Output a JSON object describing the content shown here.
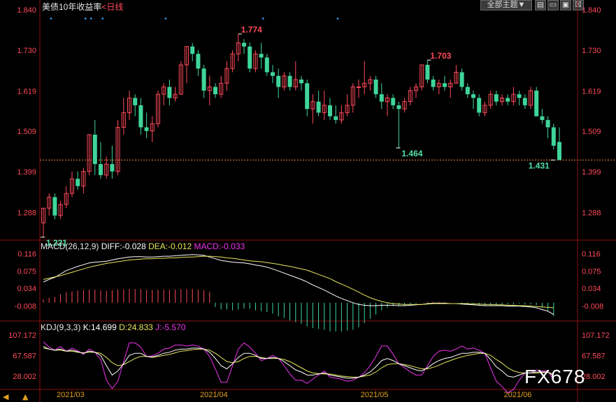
{
  "header": {
    "title": "美债10年收益率",
    "period_label": "<日线",
    "theme_button": "全部主题▼"
  },
  "colors": {
    "up": "#ff4a5a",
    "down": "#3fd59a",
    "label_up": "#ff4a5a",
    "label_down": "#54e0a6",
    "diff": "#ffffff",
    "dea": "#e6e65c",
    "macd": "#ee33ee",
    "k": "#ffffff",
    "d": "#e6e65c",
    "j": "#ee33ee",
    "axis_text": "#ff4a5a",
    "x_axis_text": "#e0a020",
    "grid": "#8b1010",
    "current_line": "#ff8c3a"
  },
  "chart_data": [
    {
      "type": "candlestick",
      "title": "美债10年收益率",
      "y_ticks": [
        "1.840",
        "1.730",
        "1.619",
        "1.509",
        "1.399",
        "1.288"
      ],
      "ylim": [
        1.215,
        1.84
      ],
      "x_ticks": [
        "2021/03",
        "2021/04",
        "2021/05",
        "2021/06"
      ],
      "current_value": 1.431,
      "annotations": [
        {
          "text": "1.774",
          "value": 1.774,
          "kind": "high"
        },
        {
          "text": "1.703",
          "value": 1.703,
          "kind": "high"
        },
        {
          "text": "1.464",
          "value": 1.464,
          "kind": "low"
        },
        {
          "text": "1.431",
          "value": 1.431,
          "kind": "low"
        },
        {
          "text": "1.221",
          "value": 1.221,
          "kind": "low"
        }
      ],
      "candles": [
        {
          "o": 1.26,
          "h": 1.3,
          "l": 1.221,
          "c": 1.3
        },
        {
          "o": 1.3,
          "h": 1.34,
          "l": 1.28,
          "c": 1.33
        },
        {
          "o": 1.33,
          "h": 1.34,
          "l": 1.27,
          "c": 1.28
        },
        {
          "o": 1.28,
          "h": 1.32,
          "l": 1.27,
          "c": 1.31
        },
        {
          "o": 1.31,
          "h": 1.36,
          "l": 1.3,
          "c": 1.34
        },
        {
          "o": 1.34,
          "h": 1.4,
          "l": 1.33,
          "c": 1.38
        },
        {
          "o": 1.38,
          "h": 1.4,
          "l": 1.35,
          "c": 1.36
        },
        {
          "o": 1.36,
          "h": 1.41,
          "l": 1.34,
          "c": 1.4
        },
        {
          "o": 1.4,
          "h": 1.5,
          "l": 1.39,
          "c": 1.5
        },
        {
          "o": 1.5,
          "h": 1.54,
          "l": 1.39,
          "c": 1.42
        },
        {
          "o": 1.42,
          "h": 1.48,
          "l": 1.38,
          "c": 1.39
        },
        {
          "o": 1.39,
          "h": 1.44,
          "l": 1.38,
          "c": 1.42
        },
        {
          "o": 1.42,
          "h": 1.47,
          "l": 1.38,
          "c": 1.4
        },
        {
          "o": 1.4,
          "h": 1.54,
          "l": 1.39,
          "c": 1.52
        },
        {
          "o": 1.52,
          "h": 1.6,
          "l": 1.5,
          "c": 1.56
        },
        {
          "o": 1.56,
          "h": 1.62,
          "l": 1.54,
          "c": 1.6
        },
        {
          "o": 1.6,
          "h": 1.61,
          "l": 1.55,
          "c": 1.58
        },
        {
          "o": 1.58,
          "h": 1.6,
          "l": 1.5,
          "c": 1.52
        },
        {
          "o": 1.52,
          "h": 1.56,
          "l": 1.49,
          "c": 1.51
        },
        {
          "o": 1.51,
          "h": 1.55,
          "l": 1.48,
          "c": 1.53
        },
        {
          "o": 1.53,
          "h": 1.62,
          "l": 1.52,
          "c": 1.61
        },
        {
          "o": 1.61,
          "h": 1.64,
          "l": 1.58,
          "c": 1.63
        },
        {
          "o": 1.63,
          "h": 1.65,
          "l": 1.58,
          "c": 1.6
        },
        {
          "o": 1.6,
          "h": 1.63,
          "l": 1.59,
          "c": 1.61
        },
        {
          "o": 1.61,
          "h": 1.7,
          "l": 1.61,
          "c": 1.69
        },
        {
          "o": 1.69,
          "h": 1.74,
          "l": 1.64,
          "c": 1.74
        },
        {
          "o": 1.74,
          "h": 1.75,
          "l": 1.7,
          "c": 1.72
        },
        {
          "o": 1.72,
          "h": 1.73,
          "l": 1.66,
          "c": 1.68
        },
        {
          "o": 1.68,
          "h": 1.69,
          "l": 1.6,
          "c": 1.62
        },
        {
          "o": 1.62,
          "h": 1.66,
          "l": 1.58,
          "c": 1.63
        },
        {
          "o": 1.63,
          "h": 1.64,
          "l": 1.6,
          "c": 1.61
        },
        {
          "o": 1.61,
          "h": 1.66,
          "l": 1.6,
          "c": 1.64
        },
        {
          "o": 1.64,
          "h": 1.7,
          "l": 1.62,
          "c": 1.68
        },
        {
          "o": 1.68,
          "h": 1.73,
          "l": 1.67,
          "c": 1.72
        },
        {
          "o": 1.72,
          "h": 1.774,
          "l": 1.7,
          "c": 1.75
        },
        {
          "o": 1.75,
          "h": 1.76,
          "l": 1.72,
          "c": 1.74
        },
        {
          "o": 1.74,
          "h": 1.75,
          "l": 1.67,
          "c": 1.68
        },
        {
          "o": 1.68,
          "h": 1.73,
          "l": 1.67,
          "c": 1.72
        },
        {
          "o": 1.72,
          "h": 1.75,
          "l": 1.68,
          "c": 1.71
        },
        {
          "o": 1.71,
          "h": 1.72,
          "l": 1.66,
          "c": 1.67
        },
        {
          "o": 1.67,
          "h": 1.69,
          "l": 1.64,
          "c": 1.66
        },
        {
          "o": 1.66,
          "h": 1.68,
          "l": 1.6,
          "c": 1.63
        },
        {
          "o": 1.63,
          "h": 1.67,
          "l": 1.62,
          "c": 1.66
        },
        {
          "o": 1.66,
          "h": 1.67,
          "l": 1.62,
          "c": 1.63
        },
        {
          "o": 1.63,
          "h": 1.7,
          "l": 1.62,
          "c": 1.65
        },
        {
          "o": 1.65,
          "h": 1.66,
          "l": 1.62,
          "c": 1.64
        },
        {
          "o": 1.64,
          "h": 1.65,
          "l": 1.55,
          "c": 1.57
        },
        {
          "o": 1.57,
          "h": 1.61,
          "l": 1.53,
          "c": 1.59
        },
        {
          "o": 1.59,
          "h": 1.62,
          "l": 1.55,
          "c": 1.56
        },
        {
          "o": 1.56,
          "h": 1.62,
          "l": 1.54,
          "c": 1.58
        },
        {
          "o": 1.58,
          "h": 1.6,
          "l": 1.54,
          "c": 1.55
        },
        {
          "o": 1.55,
          "h": 1.58,
          "l": 1.53,
          "c": 1.54
        },
        {
          "o": 1.54,
          "h": 1.58,
          "l": 1.53,
          "c": 1.56
        },
        {
          "o": 1.56,
          "h": 1.61,
          "l": 1.55,
          "c": 1.58
        },
        {
          "o": 1.58,
          "h": 1.64,
          "l": 1.56,
          "c": 1.63
        },
        {
          "o": 1.63,
          "h": 1.65,
          "l": 1.6,
          "c": 1.63
        },
        {
          "o": 1.63,
          "h": 1.7,
          "l": 1.61,
          "c": 1.64
        },
        {
          "o": 1.64,
          "h": 1.66,
          "l": 1.62,
          "c": 1.65
        },
        {
          "o": 1.65,
          "h": 1.66,
          "l": 1.6,
          "c": 1.61
        },
        {
          "o": 1.61,
          "h": 1.64,
          "l": 1.57,
          "c": 1.59
        },
        {
          "o": 1.59,
          "h": 1.61,
          "l": 1.55,
          "c": 1.6
        },
        {
          "o": 1.6,
          "h": 1.61,
          "l": 1.57,
          "c": 1.58
        },
        {
          "o": 1.58,
          "h": 1.59,
          "l": 1.464,
          "c": 1.57
        },
        {
          "o": 1.57,
          "h": 1.6,
          "l": 1.56,
          "c": 1.59
        },
        {
          "o": 1.59,
          "h": 1.63,
          "l": 1.58,
          "c": 1.62
        },
        {
          "o": 1.62,
          "h": 1.64,
          "l": 1.6,
          "c": 1.63
        },
        {
          "o": 1.63,
          "h": 1.69,
          "l": 1.62,
          "c": 1.69
        },
        {
          "o": 1.69,
          "h": 1.703,
          "l": 1.64,
          "c": 1.65
        },
        {
          "o": 1.65,
          "h": 1.66,
          "l": 1.62,
          "c": 1.63
        },
        {
          "o": 1.63,
          "h": 1.65,
          "l": 1.61,
          "c": 1.64
        },
        {
          "o": 1.64,
          "h": 1.66,
          "l": 1.62,
          "c": 1.63
        },
        {
          "o": 1.63,
          "h": 1.65,
          "l": 1.6,
          "c": 1.64
        },
        {
          "o": 1.64,
          "h": 1.69,
          "l": 1.64,
          "c": 1.67
        },
        {
          "o": 1.67,
          "h": 1.68,
          "l": 1.62,
          "c": 1.63
        },
        {
          "o": 1.63,
          "h": 1.64,
          "l": 1.6,
          "c": 1.61
        },
        {
          "o": 1.61,
          "h": 1.62,
          "l": 1.57,
          "c": 1.6
        },
        {
          "o": 1.6,
          "h": 1.61,
          "l": 1.55,
          "c": 1.56
        },
        {
          "o": 1.56,
          "h": 1.59,
          "l": 1.55,
          "c": 1.58
        },
        {
          "o": 1.58,
          "h": 1.62,
          "l": 1.57,
          "c": 1.61
        },
        {
          "o": 1.61,
          "h": 1.62,
          "l": 1.58,
          "c": 1.59
        },
        {
          "o": 1.59,
          "h": 1.61,
          "l": 1.58,
          "c": 1.6
        },
        {
          "o": 1.6,
          "h": 1.61,
          "l": 1.58,
          "c": 1.59
        },
        {
          "o": 1.59,
          "h": 1.63,
          "l": 1.58,
          "c": 1.61
        },
        {
          "o": 1.61,
          "h": 1.62,
          "l": 1.58,
          "c": 1.6
        },
        {
          "o": 1.6,
          "h": 1.61,
          "l": 1.57,
          "c": 1.58
        },
        {
          "o": 1.58,
          "h": 1.63,
          "l": 1.57,
          "c": 1.62
        },
        {
          "o": 1.62,
          "h": 1.63,
          "l": 1.55,
          "c": 1.55
        },
        {
          "o": 1.55,
          "h": 1.57,
          "l": 1.53,
          "c": 1.54
        },
        {
          "o": 1.54,
          "h": 1.55,
          "l": 1.49,
          "c": 1.52
        },
        {
          "o": 1.52,
          "h": 1.53,
          "l": 1.46,
          "c": 1.47
        },
        {
          "o": 1.48,
          "h": 1.52,
          "l": 1.431,
          "c": 1.431
        }
      ]
    },
    {
      "type": "line",
      "title": "MACD(26,12,9)",
      "legend": [
        {
          "name": "DIFF:-0.028",
          "color_key": "diff"
        },
        {
          "name": "DEA:-0.012",
          "color_key": "dea"
        },
        {
          "name": "MACD:-0.033",
          "color_key": "macd"
        }
      ],
      "y_ticks": [
        "0.116",
        "0.075",
        "0.034",
        "-0.008"
      ],
      "ylim": [
        -0.04,
        0.125
      ],
      "diff": [
        0.049,
        0.055,
        0.06,
        0.068,
        0.076,
        0.081,
        0.086,
        0.09,
        0.094,
        0.096,
        0.097,
        0.098,
        0.101,
        0.104,
        0.106,
        0.108,
        0.109,
        0.109,
        0.108,
        0.108,
        0.109,
        0.11,
        0.11,
        0.111,
        0.112,
        0.113,
        0.114,
        0.113,
        0.112,
        0.108,
        0.104,
        0.1,
        0.098,
        0.096,
        0.095,
        0.094,
        0.092,
        0.089,
        0.087,
        0.084,
        0.08,
        0.075,
        0.07,
        0.065,
        0.06,
        0.055,
        0.049,
        0.042,
        0.036,
        0.03,
        0.023,
        0.016,
        0.01,
        0.005,
        0.0,
        -0.004,
        -0.006,
        -0.007,
        -0.007,
        -0.006,
        -0.006,
        -0.006,
        -0.007,
        -0.007,
        -0.006,
        -0.005,
        -0.004,
        -0.002,
        -0.001,
        -0.001,
        -0.001,
        -0.002,
        -0.002,
        -0.003,
        -0.004,
        -0.005,
        -0.006,
        -0.007,
        -0.007,
        -0.007,
        -0.007,
        -0.008,
        -0.008,
        -0.008,
        -0.009,
        -0.01,
        -0.012,
        -0.016,
        -0.02,
        -0.028
      ],
      "dea": [
        0.055,
        0.058,
        0.061,
        0.064,
        0.068,
        0.072,
        0.076,
        0.08,
        0.084,
        0.087,
        0.09,
        0.093,
        0.095,
        0.097,
        0.099,
        0.101,
        0.102,
        0.103,
        0.104,
        0.104,
        0.105,
        0.105,
        0.106,
        0.106,
        0.107,
        0.108,
        0.108,
        0.109,
        0.11,
        0.11,
        0.109,
        0.108,
        0.106,
        0.105,
        0.103,
        0.101,
        0.099,
        0.098,
        0.097,
        0.095,
        0.093,
        0.091,
        0.088,
        0.086,
        0.083,
        0.08,
        0.077,
        0.072,
        0.067,
        0.062,
        0.057,
        0.05,
        0.044,
        0.038,
        0.032,
        0.025,
        0.018,
        0.012,
        0.007,
        0.003,
        0.0,
        -0.002,
        -0.003,
        -0.004,
        -0.004,
        -0.004,
        -0.004,
        -0.003,
        -0.002,
        -0.002,
        -0.002,
        -0.002,
        -0.002,
        -0.002,
        -0.002,
        -0.003,
        -0.003,
        -0.004,
        -0.004,
        -0.005,
        -0.005,
        -0.006,
        -0.006,
        -0.007,
        -0.007,
        -0.008,
        -0.009,
        -0.01,
        -0.011,
        -0.012
      ]
    },
    {
      "type": "line",
      "title": "KDJ(9,3,3)",
      "legend": [
        {
          "name": "K:14.699",
          "color_key": "k"
        },
        {
          "name": "D:24.833",
          "color_key": "d"
        },
        {
          "name": "J:-5.570",
          "color_key": "j"
        }
      ],
      "y_ticks": [
        "107.172",
        "67.587",
        "28.002"
      ],
      "ylim": [
        5,
        118
      ],
      "k": [
        85,
        80,
        78,
        80,
        76,
        78,
        75,
        72,
        76,
        74,
        68,
        48,
        30,
        38,
        52,
        68,
        72,
        72,
        66,
        65,
        68,
        72,
        74,
        78,
        80,
        80,
        82,
        82,
        80,
        74,
        62,
        48,
        42,
        52,
        64,
        72,
        72,
        68,
        62,
        62,
        64,
        62,
        56,
        48,
        40,
        36,
        30,
        30,
        32,
        34,
        30,
        28,
        26,
        24,
        24,
        26,
        30,
        36,
        46,
        58,
        62,
        58,
        52,
        48,
        44,
        40,
        38,
        44,
        52,
        58,
        62,
        64,
        68,
        72,
        72,
        74,
        74,
        72,
        60,
        46,
        38,
        28,
        26,
        30,
        34,
        34,
        36,
        36,
        36,
        28
      ],
      "d": [
        82,
        80,
        78,
        78,
        76,
        76,
        74,
        73,
        74,
        74,
        72,
        64,
        54,
        48,
        50,
        56,
        62,
        66,
        66,
        64,
        66,
        68,
        70,
        73,
        76,
        77,
        79,
        80,
        80,
        78,
        72,
        64,
        56,
        54,
        56,
        62,
        66,
        66,
        64,
        62,
        62,
        62,
        60,
        56,
        50,
        44,
        38,
        34,
        33,
        32,
        32,
        30,
        28,
        27,
        26,
        26,
        28,
        30,
        36,
        44,
        50,
        52,
        52,
        50,
        48,
        45,
        42,
        42,
        45,
        49,
        54,
        58,
        62,
        65,
        68,
        70,
        72,
        72,
        68,
        60,
        53,
        44,
        38,
        35,
        34,
        34,
        34,
        35,
        35,
        32
      ],
      "j": [
        94,
        84,
        78,
        85,
        76,
        82,
        77,
        70,
        80,
        74,
        60,
        20,
        4,
        18,
        56,
        92,
        92,
        84,
        66,
        67,
        72,
        80,
        82,
        88,
        88,
        86,
        88,
        86,
        80,
        66,
        42,
        16,
        16,
        48,
        80,
        92,
        84,
        72,
        58,
        62,
        68,
        62,
        48,
        32,
        20,
        20,
        14,
        22,
        30,
        38,
        26,
        24,
        22,
        18,
        20,
        26,
        34,
        48,
        66,
        86,
        86,
        70,
        52,
        44,
        36,
        30,
        30,
        48,
        66,
        76,
        78,
        76,
        80,
        86,
        80,
        82,
        78,
        72,
        44,
        18,
        8,
        -4,
        2,
        20,
        34,
        34,
        40,
        38,
        38,
        20
      ]
    }
  ]
}
